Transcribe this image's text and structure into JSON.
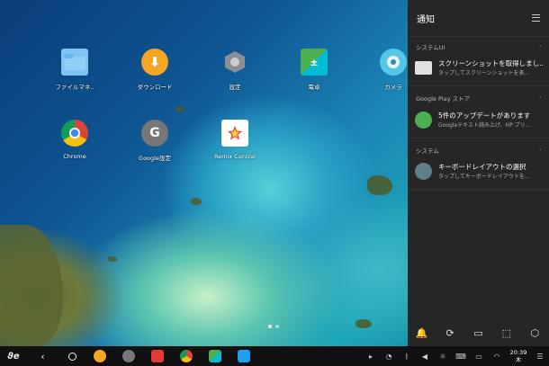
{
  "desktop": {
    "icons": [
      {
        "label": "ファイルマネ..",
        "icon": "folder-icon",
        "color": "#7fc4f2"
      },
      {
        "label": "ダウンロード",
        "icon": "download-icon",
        "color": "#f5a623"
      },
      {
        "label": "設定",
        "icon": "settings-hex-icon",
        "color": "#8a8f93"
      },
      {
        "label": "電卓",
        "icon": "calculator-icon",
        "color": "#4caf50"
      },
      {
        "label": "カメラ",
        "icon": "camera-icon",
        "color": "#55c7e6"
      },
      {
        "label": "Chrome",
        "icon": "chrome-icon",
        "color": "#db4437"
      },
      {
        "label": "Google設定",
        "icon": "google-settings-icon",
        "color": "#777777"
      },
      {
        "label": "Remix Central",
        "icon": "remix-central-icon",
        "color": "#ffffff"
      }
    ],
    "google_letter": "G"
  },
  "notifications": {
    "title": "通知",
    "sections": [
      {
        "header": "システムUI",
        "title": "スクリーンショットを取得しまし...",
        "subtitle": "タップしてスクリーンショットを表...",
        "icon": "screenshot-thumb-icon",
        "color": "#e0e0e0"
      },
      {
        "header": "Google Play ストア",
        "title": "5件のアップデートがあります",
        "subtitle": "Googleテキスト読み上げ、HP プリ...",
        "icon": "play-store-update-icon",
        "color": "#4caf50"
      },
      {
        "header": "システム",
        "title": "キーボードレイアウトの選択",
        "subtitle": "タップしてキーボードレイアウトを...",
        "icon": "keyboard-icon",
        "color": "#607d8b"
      }
    ],
    "quick_settings": [
      "bell-icon",
      "rotate-icon",
      "screen-cast-icon",
      "screenshot-icon",
      "settings-hex-icon"
    ]
  },
  "taskbar": {
    "start_label": "Jide",
    "apps": [
      {
        "icon": "download-icon",
        "color": "#f5a623"
      },
      {
        "icon": "google-settings-icon",
        "color": "#777777"
      },
      {
        "icon": "youtube-icon",
        "color": "#e53935"
      },
      {
        "icon": "chrome-icon",
        "color": "#db4437"
      },
      {
        "icon": "calculator-icon",
        "color": "#4caf50"
      },
      {
        "icon": "twitter-icon",
        "color": "#1da1f2"
      }
    ],
    "clock_time": "20:39",
    "clock_day": "木"
  }
}
